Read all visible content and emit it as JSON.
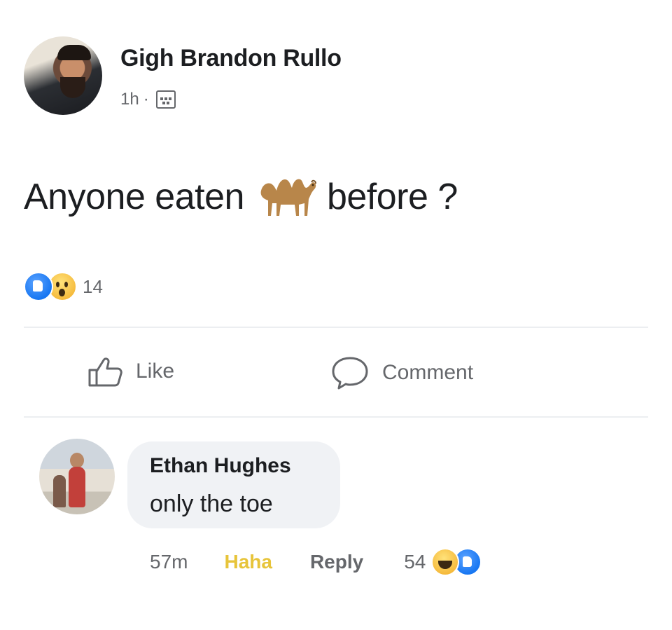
{
  "post": {
    "author": "Gigh Brandon Rullo",
    "time": "1h",
    "separator": "·",
    "privacy_icon": "group-icon",
    "text_before": "Anyone eaten",
    "emoji": "camel-icon",
    "text_after": "before ?"
  },
  "reactions": {
    "icons": [
      "like-reaction-icon",
      "wow-reaction-icon"
    ],
    "count": "14"
  },
  "actions": {
    "like_label": "Like",
    "comment_label": "Comment"
  },
  "comment": {
    "author": "Ethan Hughes",
    "text": "only the toe",
    "time": "57m",
    "haha_label": "Haha",
    "reply_label": "Reply",
    "reaction_count": "54",
    "reaction_icons": [
      "haha-reaction-icon",
      "like-reaction-icon"
    ]
  },
  "colors": {
    "primary_text": "#1c1e21",
    "secondary_text": "#65676b",
    "haha_yellow": "#e7c43a",
    "like_blue": "#1877f2",
    "bubble_bg": "#f0f2f5"
  }
}
